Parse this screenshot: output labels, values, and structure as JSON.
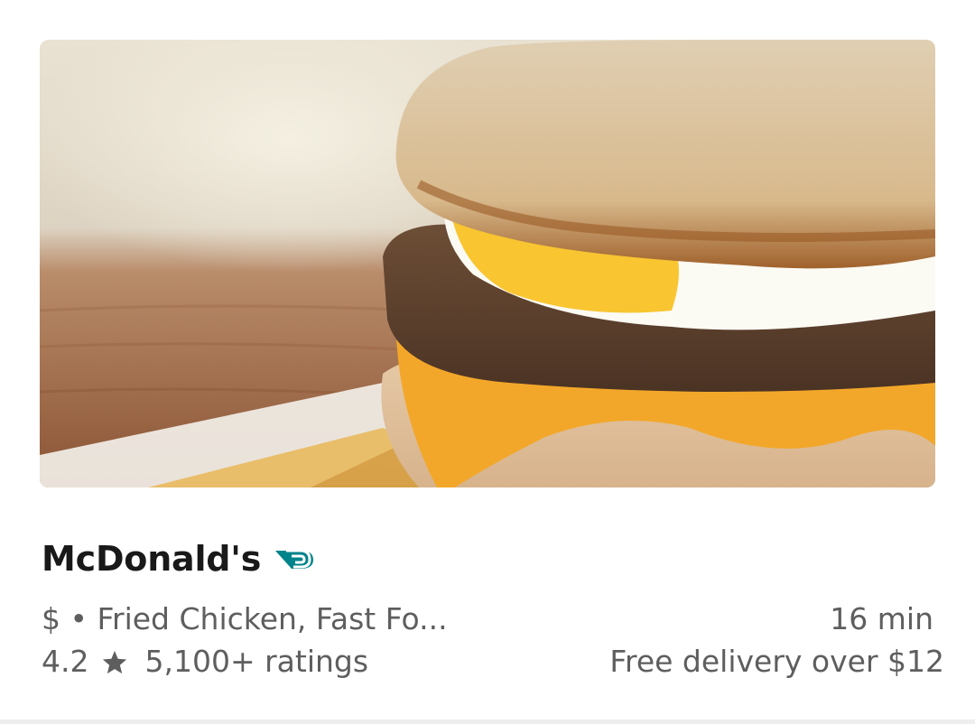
{
  "store": {
    "name": "McDonald's",
    "badge_icon": "dashpass-icon",
    "price_and_cuisine": "$ • Fried Chicken, Fast Fo...",
    "rating": "4.2",
    "rating_icon": "star-icon",
    "ratings_count": "5,100+ ratings",
    "delivery_time": "16 min",
    "delivery_fee": "Free delivery over $12"
  },
  "colors": {
    "title": "#191919",
    "meta": "#5e5e5e",
    "badge": "#00838a"
  }
}
